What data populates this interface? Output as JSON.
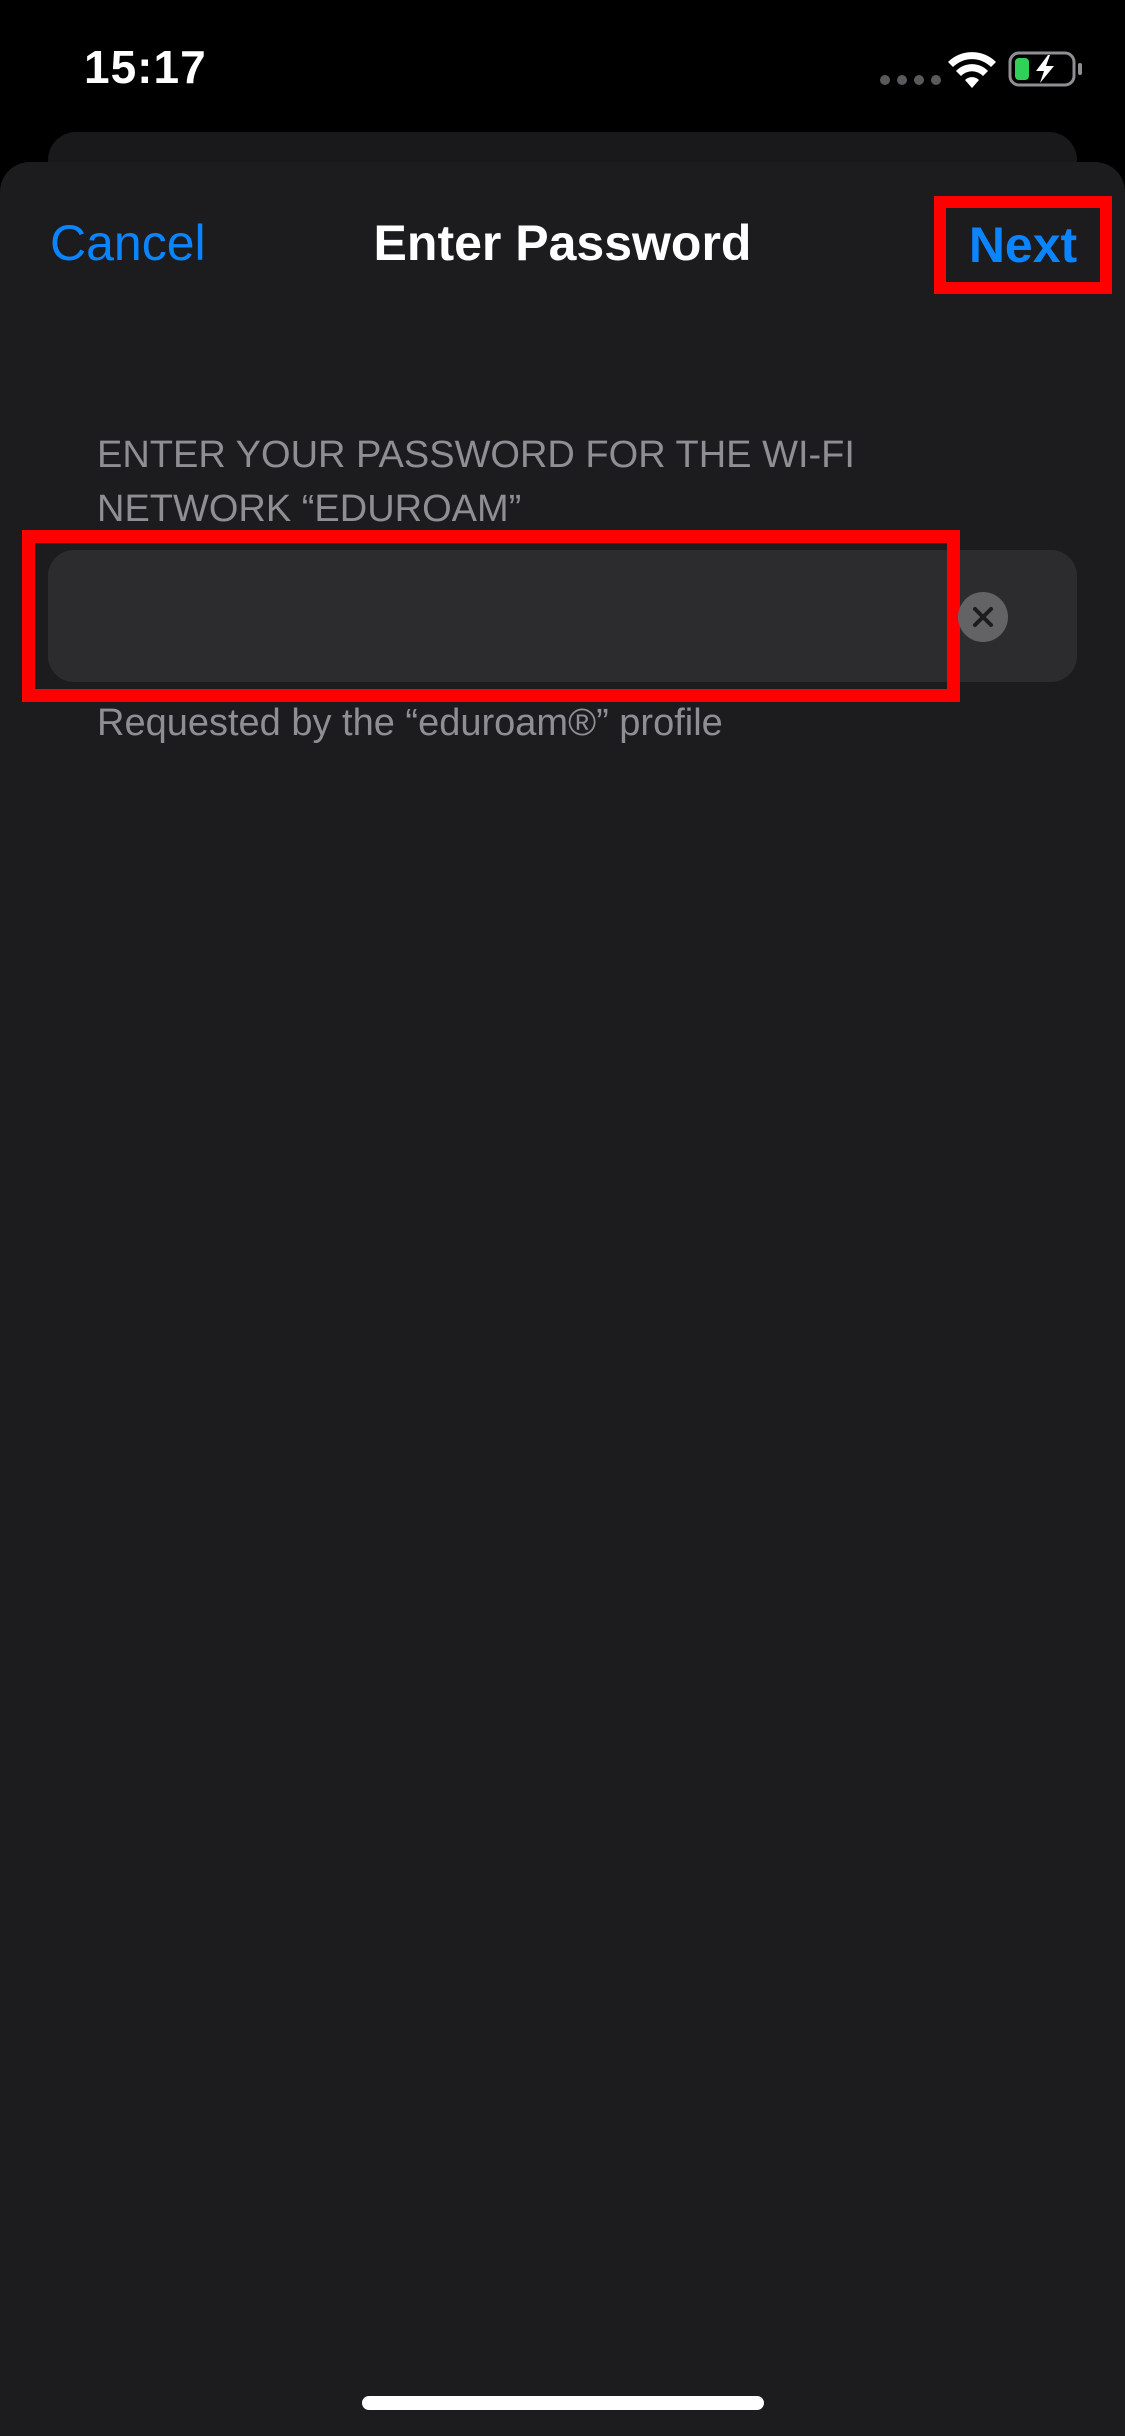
{
  "status_bar": {
    "time": "15:17",
    "wifi_icon": "wifi-icon",
    "battery_icon": "battery-charging-icon",
    "battery_color": "#30d158"
  },
  "nav": {
    "cancel_label": "Cancel",
    "title": "Enter Password",
    "next_label": "Next"
  },
  "form": {
    "header": "ENTER YOUR PASSWORD FOR THE WI-FI NETWORK “EDUROAM”",
    "password_value": "",
    "clear_icon": "clear-circle-icon",
    "footer": "Requested by the “eduroam®” profile"
  },
  "colors": {
    "accent": "#0a84ff",
    "highlight": "#ff0000",
    "sheet_background": "#1c1c1e",
    "field_background": "#2c2c2e",
    "secondary_text": "#8e8e93"
  }
}
